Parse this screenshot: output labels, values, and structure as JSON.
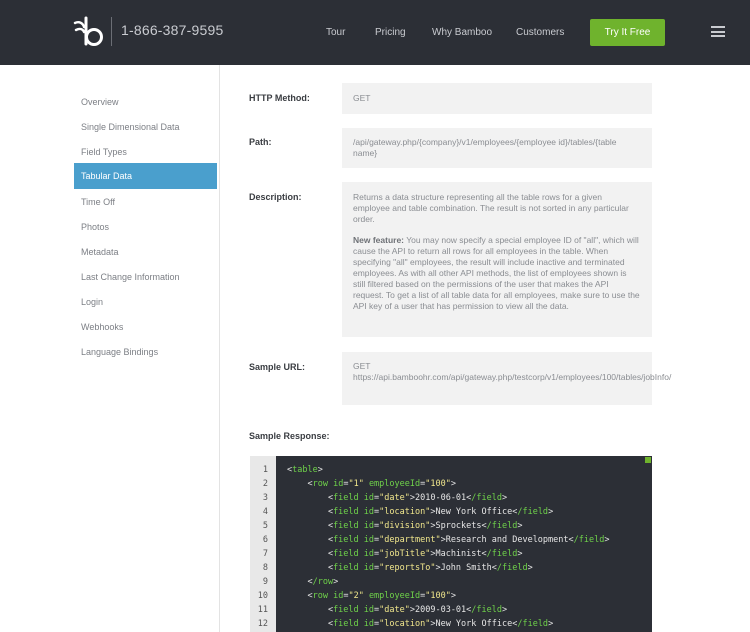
{
  "header": {
    "phone": "1-866-387-9595",
    "nav": [
      "Tour",
      "Pricing",
      "Why Bamboo",
      "Customers"
    ],
    "cta_label": "Try It Free"
  },
  "sidebar": {
    "items": [
      {
        "label": "Overview",
        "active": false
      },
      {
        "label": "Single Dimensional Data",
        "active": false
      },
      {
        "label": "Field Types",
        "active": false
      },
      {
        "label": "Tabular Data",
        "active": true
      },
      {
        "label": "Time Off",
        "active": false
      },
      {
        "label": "Photos",
        "active": false
      },
      {
        "label": "Metadata",
        "active": false
      },
      {
        "label": "Last Change Information",
        "active": false
      },
      {
        "label": "Login",
        "active": false
      },
      {
        "label": "Webhooks",
        "active": false
      },
      {
        "label": "Language Bindings",
        "active": false
      }
    ]
  },
  "main": {
    "http_method": {
      "label": "HTTP Method:",
      "value": "GET"
    },
    "path": {
      "label": "Path:",
      "value": "/api/gateway.php/{company}/v1/employees/{employee id}/tables/{table name}"
    },
    "description": {
      "label": "Description:",
      "text": "Returns a data structure representing all the table rows for a given employee and table combination. The result is not sorted in any particular order.",
      "new_feature_label": "New feature:",
      "new_feature_text": " You may now specify a special employee ID of \"all\", which will cause the API to return all rows for all employees in the table. When specifying \"all\" employees, the result will include inactive and terminated employees. As with all other API methods, the list of employees shown is still filtered based on the permissions of the user that makes the API request. To get a list of all table data for all employees, make sure to use the API key of a user that has permission to view all the data."
    },
    "sample_url": {
      "label": "Sample URL:",
      "method": "GET",
      "url": "https://api.bamboohr.com/api/gateway.php/testcorp/v1/employees/100/tables/jobInfo/"
    },
    "sample_response": {
      "label": "Sample Response:",
      "lines": [
        {
          "n": "1",
          "code": "<table>"
        },
        {
          "n": "2",
          "code": "    <row id=\"1\" employeeId=\"100\">"
        },
        {
          "n": "3",
          "code": "        <field id=\"date\">2010-06-01</field>"
        },
        {
          "n": "4",
          "code": "        <field id=\"location\">New York Office</field>"
        },
        {
          "n": "5",
          "code": "        <field id=\"division\">Sprockets</field>"
        },
        {
          "n": "6",
          "code": "        <field id=\"department\">Research and Development</field>"
        },
        {
          "n": "7",
          "code": "        <field id=\"jobTitle\">Machinist</field>"
        },
        {
          "n": "8",
          "code": "        <field id=\"reportsTo\">John Smith</field>"
        },
        {
          "n": "9",
          "code": "    </row>"
        },
        {
          "n": "10",
          "code": "    <row id=\"2\" employeeId=\"100\">"
        },
        {
          "n": "11",
          "code": "        <field id=\"date\">2009-03-01</field>"
        },
        {
          "n": "12",
          "code": "        <field id=\"location\">New York Office</field>"
        }
      ]
    }
  },
  "colors": {
    "header_bg": "#2c2f36",
    "cta": "#6fb32d",
    "active_item": "#4a9fcd",
    "code_bg": "#2c2f36",
    "code_tag": "#6fd24a",
    "code_attr_value": "#f0e68c"
  },
  "icons": {
    "logo": "bamboo-logo-icon",
    "menu": "hamburger-menu-icon",
    "code_corner": "expand-icon"
  }
}
